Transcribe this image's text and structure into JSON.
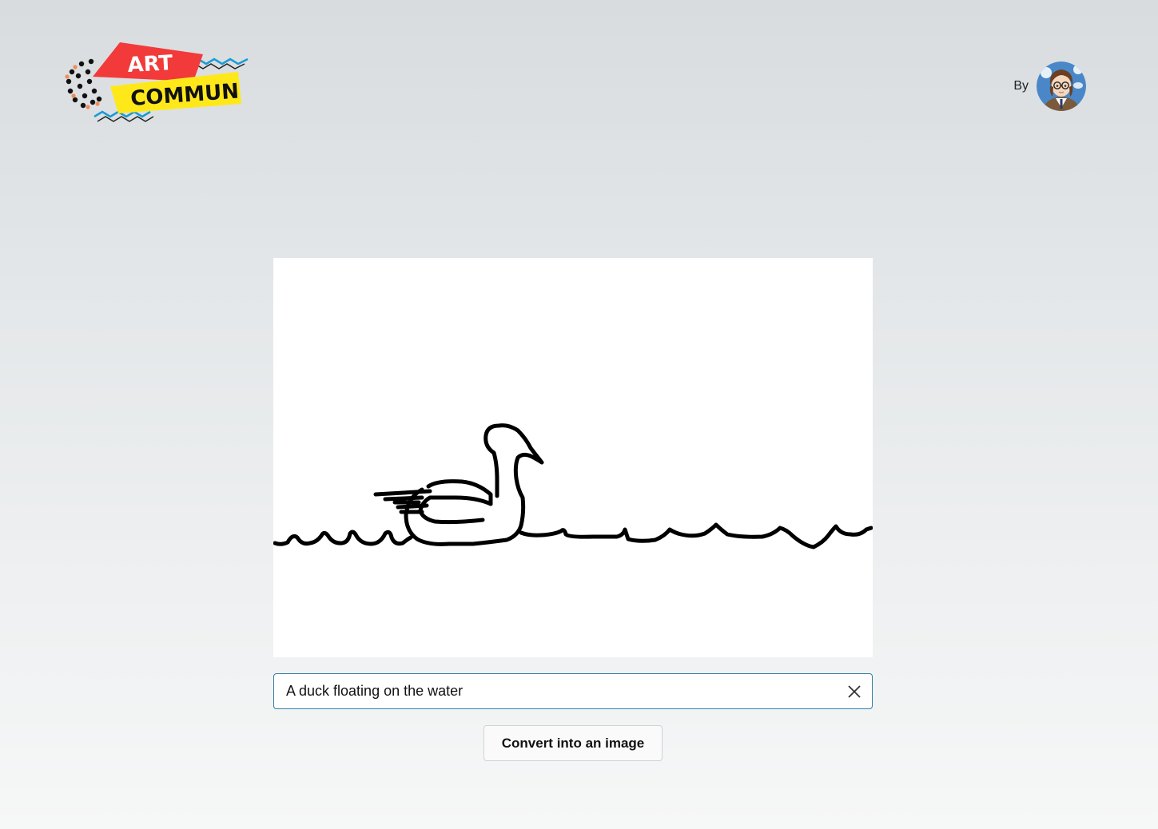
{
  "header": {
    "logo_line1": "ART",
    "logo_line2": "COMMUN",
    "author_label": "By",
    "avatar_icon": "avatar-icon"
  },
  "canvas": {
    "drawing_icon": "duck-on-water-sketch",
    "background": "#ffffff",
    "stroke_color": "#000000"
  },
  "prompt": {
    "value": "A duck floating on the water",
    "clear_icon": "close-icon"
  },
  "actions": {
    "convert_label": "Convert into an image"
  },
  "colors": {
    "logo_red": "#f23a3a",
    "logo_yellow": "#ffe81a",
    "logo_blue": "#1a9ad6",
    "input_border": "#2f7ea8"
  }
}
